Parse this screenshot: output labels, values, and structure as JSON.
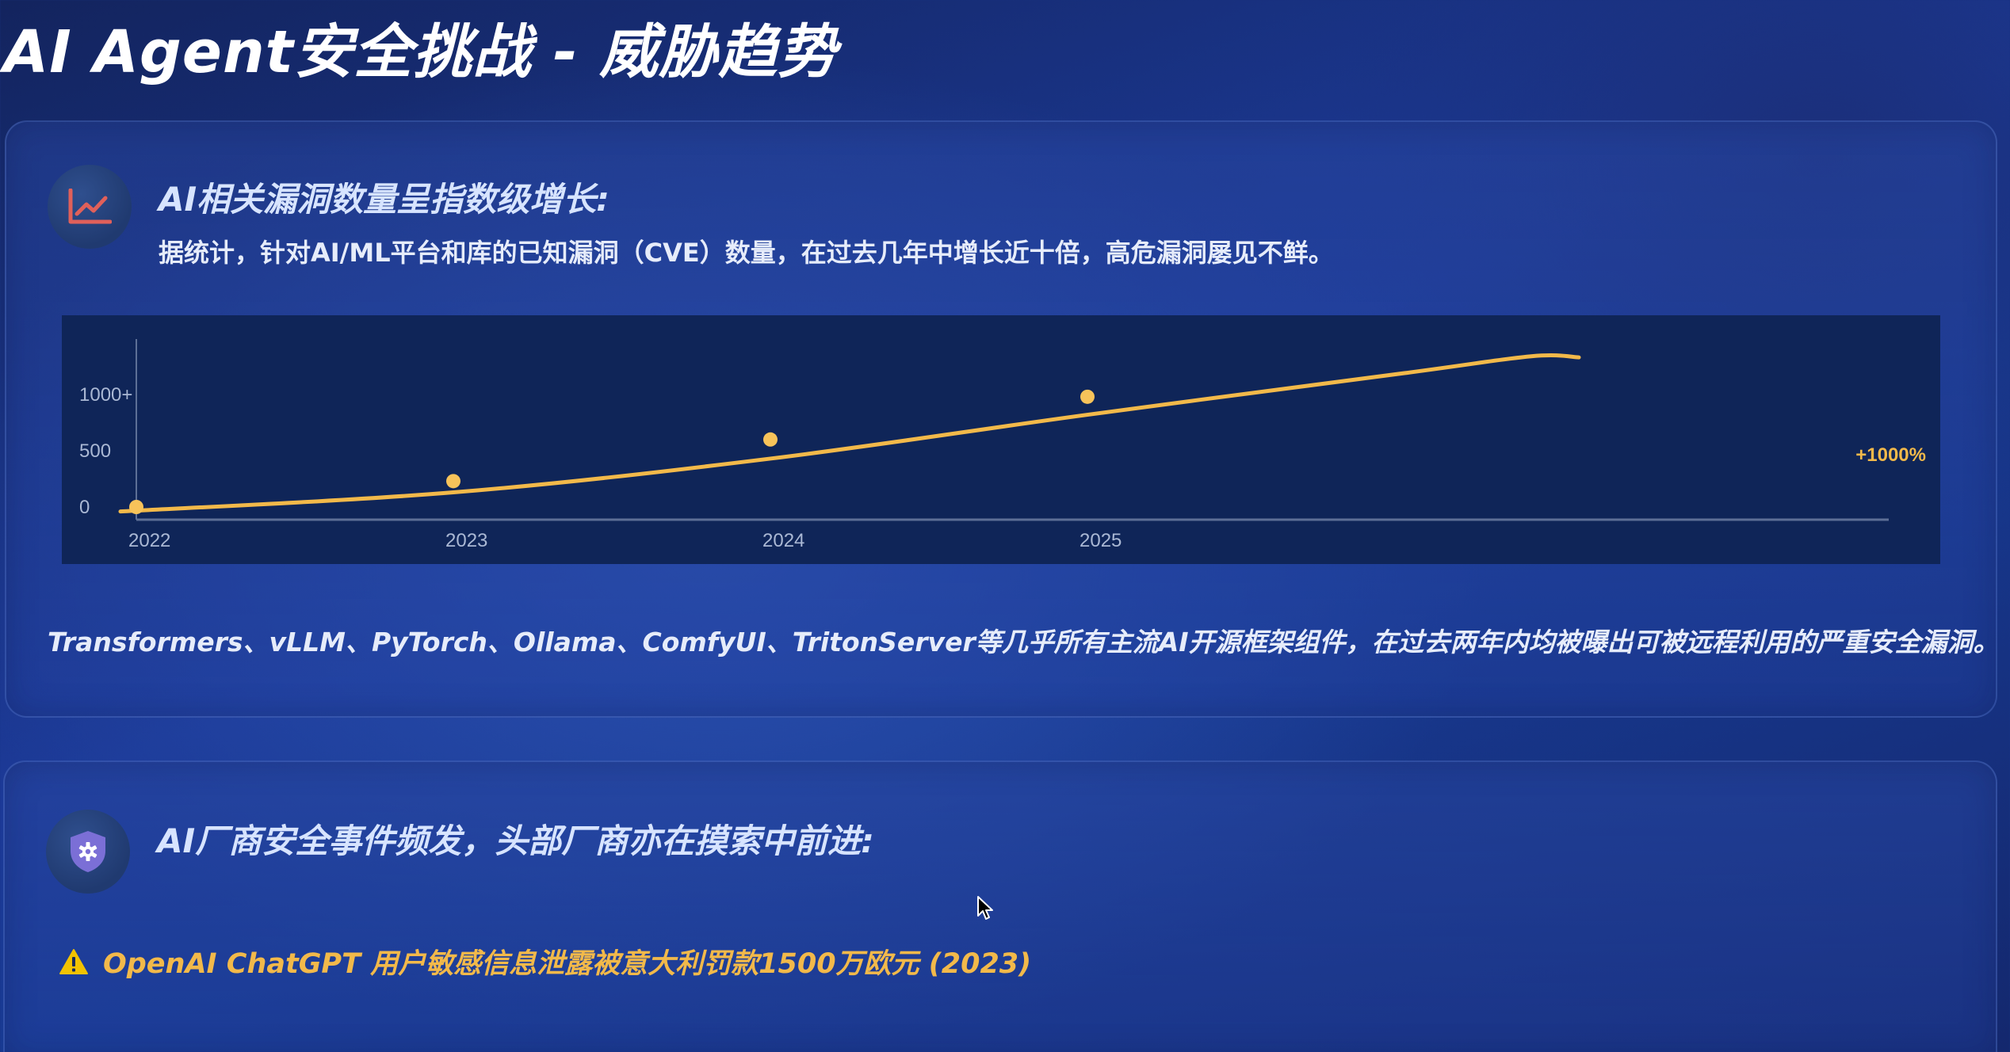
{
  "title": "AI Agent安全挑战 - 威胁趋势",
  "colors": {
    "accent": "#f2b94a",
    "chart_bg": "#0f2558",
    "icon_chart": "#e0605a",
    "icon_shield": "#7b6fd6"
  },
  "section_vulns": {
    "icon": "line-chart-icon",
    "heading": "AI相关漏洞数量呈指数级增长:",
    "description": "据统计，针对AI/ML平台和库的已知漏洞（CVE）数量，在过去几年中增长近十倍，高危漏洞屡见不鲜。",
    "note": "Transformers、vLLM、PyTorch、Ollama、ComfyUI、TritonServer等几乎所有主流AI开源框架组件，在过去两年内均被曝出可被远程利用的严重安全漏洞。"
  },
  "chart_data": {
    "type": "line",
    "categories": [
      "2022",
      "2023",
      "2024",
      "2025"
    ],
    "y_ticks": [
      "0",
      "500",
      "1000+"
    ],
    "ylim": [
      0,
      1300
    ],
    "points": [
      {
        "x": "2022",
        "y": 0
      },
      {
        "x": "2023",
        "y": 230
      },
      {
        "x": "2024",
        "y": 600
      },
      {
        "x": "2025",
        "y": 980
      }
    ],
    "trend_curve": [
      {
        "x": 2021.95,
        "y": -40
      },
      {
        "x": 2023,
        "y": 130
      },
      {
        "x": 2024,
        "y": 430
      },
      {
        "x": 2025,
        "y": 820
      },
      {
        "x": 2026,
        "y": 1190
      },
      {
        "x": 2026.4,
        "y": 1340
      },
      {
        "x": 2026.55,
        "y": 1330
      }
    ],
    "annotation": "+1000%",
    "grid": false,
    "title": "",
    "xlabel": "",
    "ylabel": ""
  },
  "section_incidents": {
    "icon": "shield-gear-icon",
    "heading": "AI厂商安全事件频发，头部厂商亦在摸索中前进:",
    "items": [
      {
        "icon": "warning-icon",
        "text": "OpenAI ChatGPT 用户敏感信息泄露被意大利罚款1500万欧元 (2023)"
      }
    ]
  }
}
